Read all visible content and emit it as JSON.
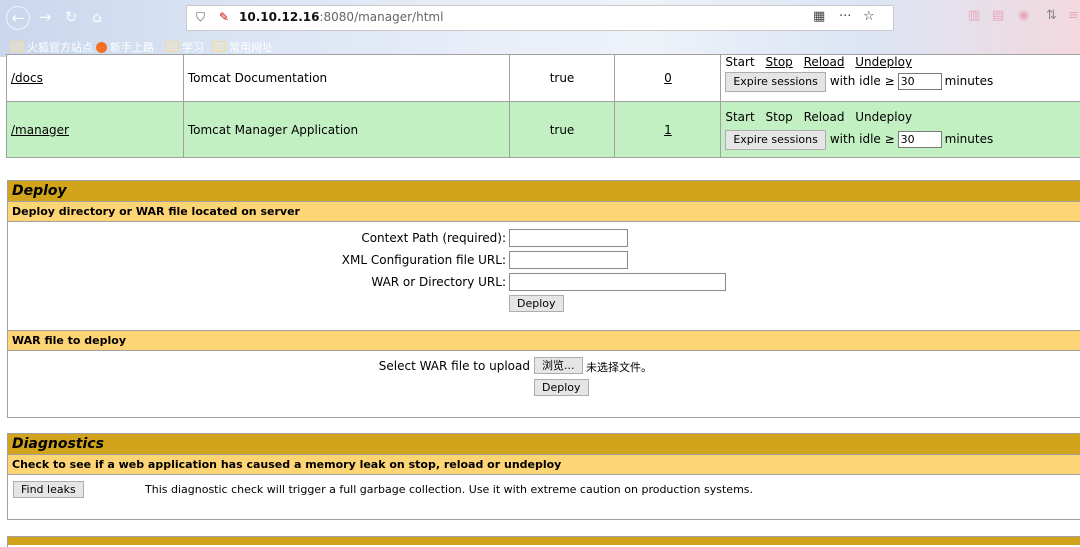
{
  "browser": {
    "url_host": "10.10.12.16",
    "url_rest": ":8080/manager/html",
    "bookmarks": [
      "火狐官方站点",
      "新手上路",
      "学习",
      "常用网址"
    ]
  },
  "apps_table": {
    "rows": [
      {
        "path": "/docs",
        "display_name": "Tomcat Documentation",
        "running": "true",
        "sessions": "0",
        "commands": [
          "Start",
          "Stop",
          "Reload",
          "Undeploy"
        ],
        "expire_label": "Expire sessions",
        "idle_prefix": "with idle ≥",
        "idle_value": "30",
        "idle_suffix": "minutes"
      },
      {
        "path": "/manager",
        "display_name": "Tomcat Manager Application",
        "running": "true",
        "sessions": "1",
        "commands": [
          "Start",
          "Stop",
          "Reload",
          "Undeploy"
        ],
        "expire_label": "Expire sessions",
        "idle_prefix": "with idle ≥",
        "idle_value": "30",
        "idle_suffix": "minutes"
      }
    ]
  },
  "deploy": {
    "title": "Deploy",
    "server_section": "Deploy directory or WAR file located on server",
    "context_label": "Context Path (required):",
    "xml_label": "XML Configuration file URL:",
    "war_dir_label": "WAR or Directory URL:",
    "deploy_button": "Deploy",
    "upload_section": "WAR file to deploy",
    "select_label": "Select WAR file to upload",
    "browse_button": "浏览...",
    "no_file": "未选择文件。",
    "upload_deploy_button": "Deploy"
  },
  "diagnostics": {
    "title": "Diagnostics",
    "section": "Check to see if a web application has caused a memory leak on stop, reload or undeploy",
    "find_leaks_button": "Find leaks",
    "description": "This diagnostic check will trigger a full garbage collection. Use it with extreme caution on production systems."
  },
  "colors": {
    "header_gold": "#d2a41c",
    "sub_yellow": "#fed575",
    "row_green": "#c3f0c3"
  }
}
